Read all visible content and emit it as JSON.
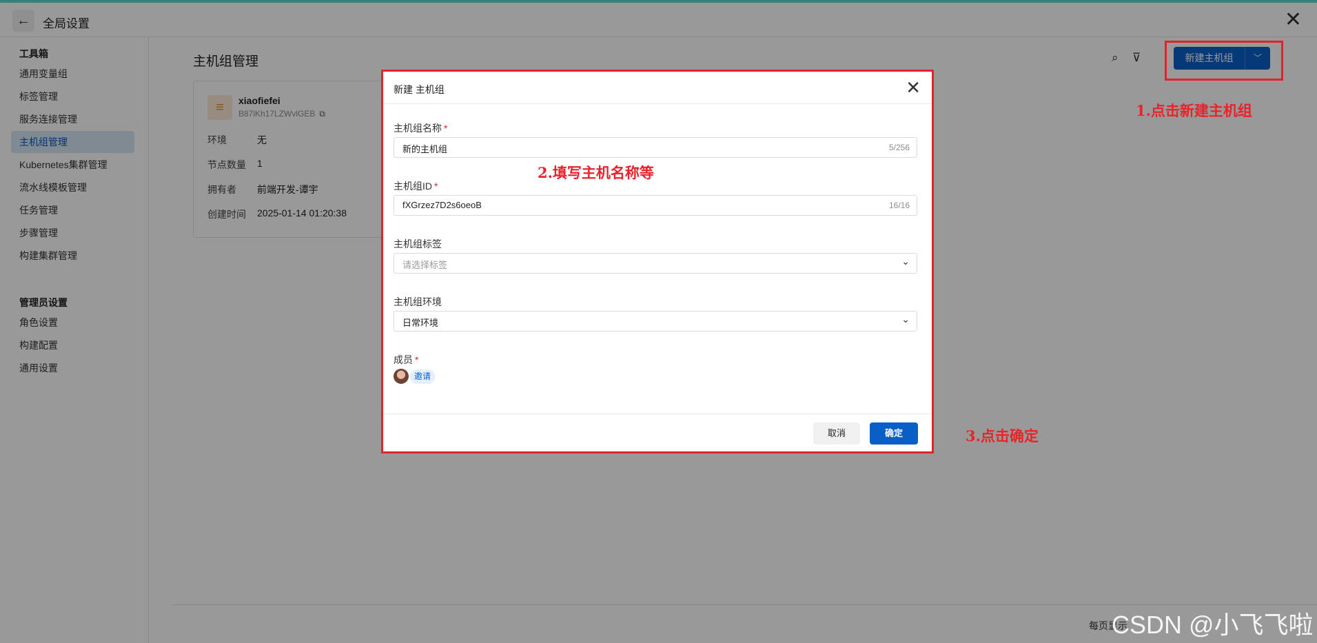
{
  "header": {
    "back_icon": "arrow-left-icon",
    "title": "全局设置",
    "close_icon": "close-icon"
  },
  "sidebar": {
    "group1": "工具箱",
    "items1": [
      "通用变量组",
      "标签管理",
      "服务连接管理",
      "主机组管理",
      "Kubernetes集群管理",
      "流水线模板管理",
      "任务管理",
      "步骤管理",
      "构建集群管理"
    ],
    "active": "主机组管理",
    "group2": "管理员设置",
    "items2": [
      "角色设置",
      "构建配置",
      "通用设置"
    ]
  },
  "main": {
    "title": "主机组管理",
    "new_button": "新建主机组",
    "card": {
      "name": "xiaofiefei",
      "id": "B87lKh17LZWvlGEB",
      "rows": [
        {
          "label": "环境",
          "value": "无"
        },
        {
          "label": "节点数量",
          "value": "1"
        },
        {
          "label": "拥有者",
          "value": "前端开发-谭宇"
        },
        {
          "label": "创建时间",
          "value": "2025-01-14 01:20:38"
        }
      ]
    },
    "pager_text": "每页显示"
  },
  "modal": {
    "title": "新建 主机组",
    "fields": {
      "name": {
        "label": "主机组名称",
        "value": "新的主机组",
        "count": "5/256"
      },
      "id": {
        "label": "主机组ID",
        "value": "fXGrzez7D2s6oeoB",
        "count": "16/16"
      },
      "tags": {
        "label": "主机组标签",
        "placeholder": "请选择标签"
      },
      "env": {
        "label": "主机组环境",
        "value": "日常环境"
      },
      "members": {
        "label": "成员",
        "invite": "邀请"
      }
    },
    "cancel": "取消",
    "ok": "确定"
  },
  "annotations": {
    "a1": "1.点击新建主机组",
    "a2": "2.填写主机名称等",
    "a3": "3.点击确定"
  },
  "watermark": "CSDN @小飞飞啦",
  "colors": {
    "primary": "#0a5fc7",
    "annotation": "#e8232b",
    "active_bg": "#d6e6f6"
  }
}
